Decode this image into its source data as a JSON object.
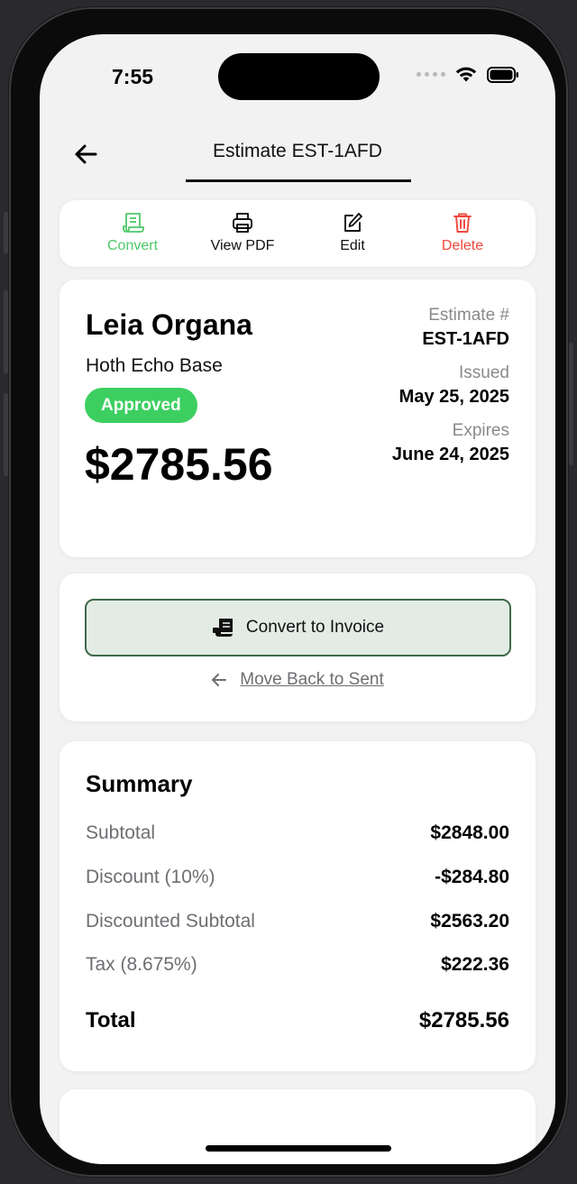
{
  "status": {
    "time": "7:55"
  },
  "header": {
    "title": "Estimate EST-1AFD"
  },
  "toolbar": {
    "items": [
      {
        "label": "Convert",
        "color": "#4cc868",
        "icon": "receipt-icon"
      },
      {
        "label": "View PDF",
        "color": "#111111",
        "icon": "printer-icon"
      },
      {
        "label": "Edit",
        "color": "#111111",
        "icon": "edit-icon"
      },
      {
        "label": "Delete",
        "color": "#f0483e",
        "icon": "trash-icon"
      }
    ]
  },
  "client": {
    "name": "Leia Organa",
    "address": "Hoth Echo Base",
    "status": "Approved",
    "amount": "$2785.56",
    "estimate_label": "Estimate #",
    "estimate_number": "EST-1AFD",
    "issued_label": "Issued",
    "issued_date": "May 25, 2025",
    "expires_label": "Expires",
    "expires_date": "June 24, 2025"
  },
  "actions": {
    "convert_label": "Convert to Invoice",
    "move_back_label": "Move Back to Sent"
  },
  "summary": {
    "title": "Summary",
    "rows": [
      {
        "label": "Subtotal",
        "value": "$2848.00"
      },
      {
        "label": "Discount (10%)",
        "value": "-$284.80"
      },
      {
        "label": "Discounted Subtotal",
        "value": "$2563.20"
      },
      {
        "label": "Tax (8.675%)",
        "value": "$222.36"
      }
    ],
    "total_label": "Total",
    "total_value": "$2785.56"
  },
  "colors": {
    "accent_green": "#3ccf60",
    "danger": "#f0483e",
    "button_border": "#3d6a4a"
  }
}
